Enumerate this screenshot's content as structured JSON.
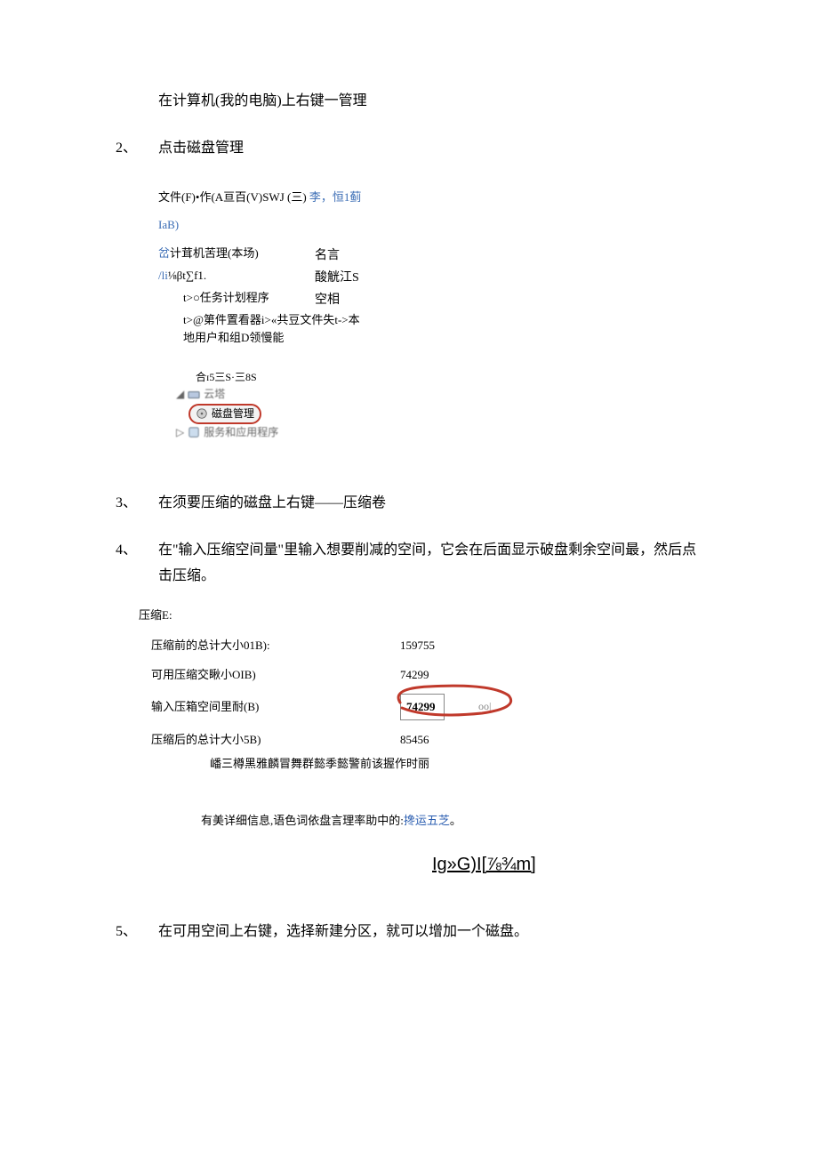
{
  "intro": "在计算机(我的电脑)上右键一管理",
  "step2": {
    "num": "2、",
    "text": "点击磁盘管理"
  },
  "menu": {
    "line1_a": "文件(F)•作(A亘百(V)SWJ  (三) ",
    "line1_b": "李，恒1蓟",
    "line2": "IaB)",
    "tree_root_a": "岔",
    "tree_root_b": "计茸机苦理(本场)",
    "tree_root_right": "名言",
    "tree_l2_a": "/li",
    "tree_l2_b": "⅛βt∑f1.",
    "tree_l2_right": "酸觥江S",
    "tree_l3": "t>○任务计划程序",
    "tree_l3_right": "空相",
    "tree_l4": "t>@第件置看器i>«共豆文件失t->本地用户和组D领慢能",
    "tree_img_top": "合ɪ5三S·三8S",
    "tree_img_storage": "云塔",
    "tree_img_disk": "磁盘管理",
    "tree_img_service": "服务和应用程序"
  },
  "step3": {
    "num": "3、",
    "text": "在须要压缩的磁盘上右键——压缩卷"
  },
  "step4": {
    "num": "4、",
    "text": "在\"输入压缩空间量\"里输入想要削减的空间，它会在后面显示破盘剩余空间最，然后点击压缩。"
  },
  "compress": {
    "title": "压缩E:",
    "r1_label": "压缩前的总计大小01B):",
    "r1_val": "159755",
    "r2_label": "可用压缩交瞅小OIB)",
    "r2_val": "74299",
    "r3_label": "输入压箱空间里耐(B)",
    "r3_val": "74299",
    "r3_oo": "oo|",
    "r4_label": "压缩后的总计大小5B)",
    "r4_val": "85456",
    "note": "嶓三樽黑雅麟冒舞群懿季懿警前该握作时丽",
    "info_a": "有美详细信息,语色词依盘言理率助中的:",
    "info_b": "搀运五芝",
    "info_c": "。",
    "biglink": "Ig»G)I[⅞¾m]"
  },
  "step5": {
    "num": "5、",
    "text": "在可用空间上右键，选择新建分区，就可以增加一个磁盘。"
  }
}
